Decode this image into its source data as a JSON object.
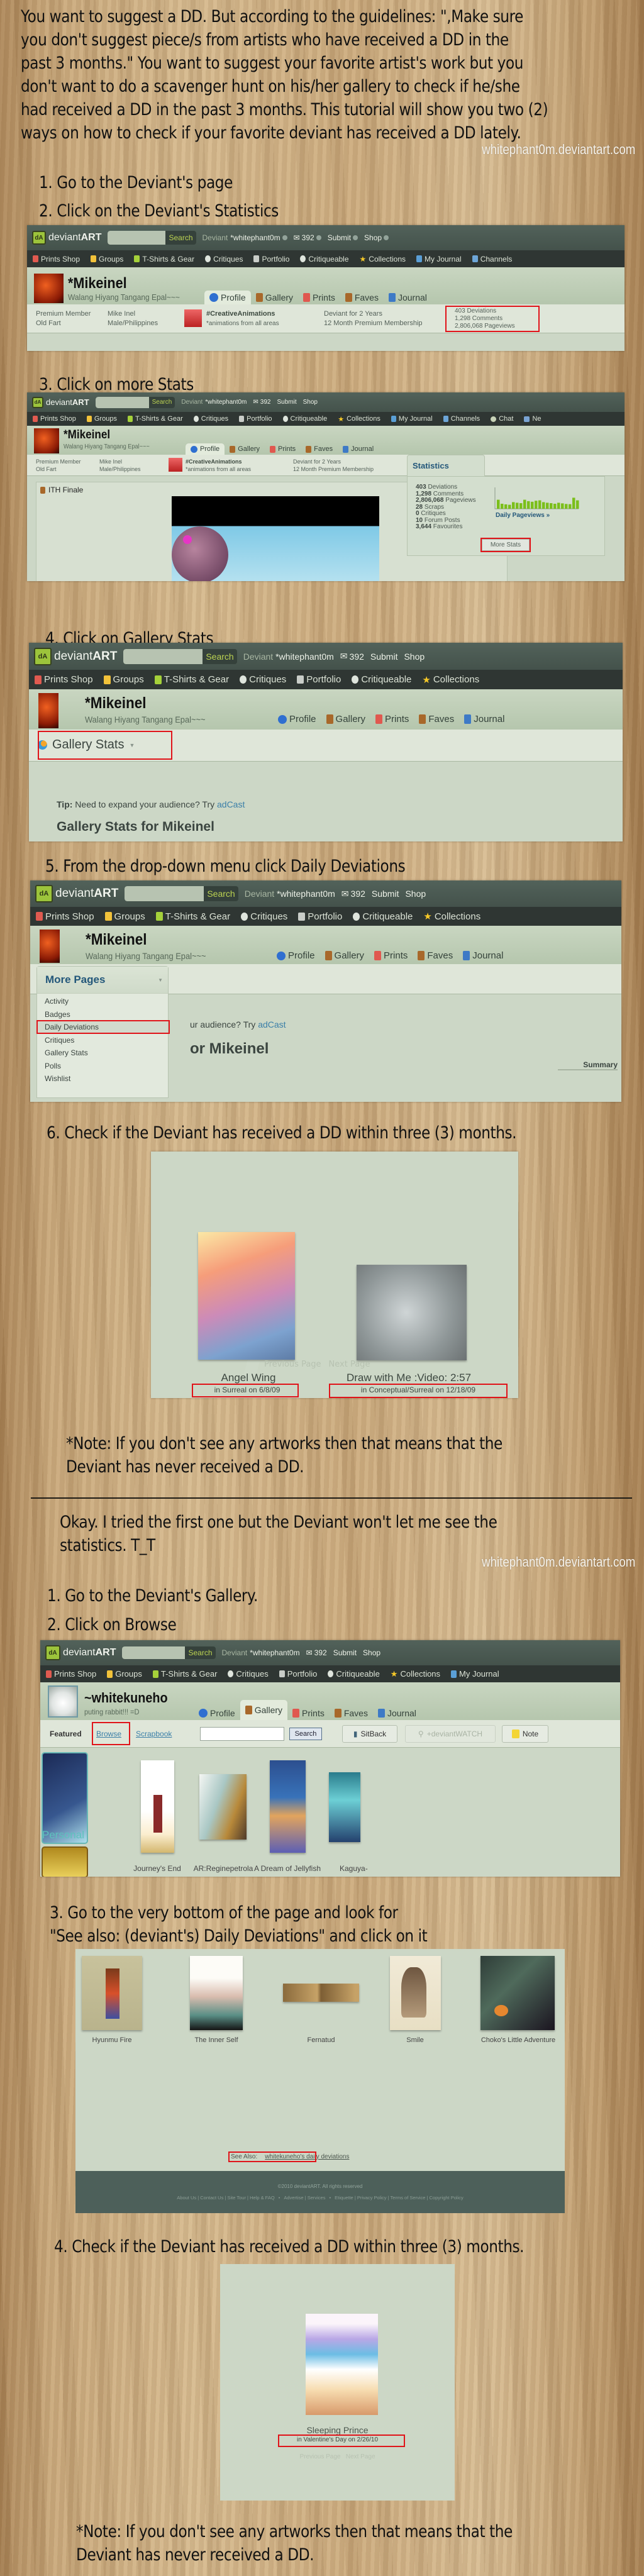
{
  "intro": {
    "lines": [
      "You want to suggest a DD. But according to the guidelines: \",Make sure",
      "you don't suggest piece/s from artists who have received a DD in the",
      "past 3 months.\" You want to suggest your favorite artist's work but you",
      "don't want to do a scavenger hunt on his/her gallery to check if he/she",
      "had received a DD in the past 3 months. This tutorial will show you two (2)",
      "ways on how to check if your favorite deviant has received a DD lately."
    ],
    "watermark": "whitephant0m.deviantart.com"
  },
  "da_chrome": {
    "logo_text_light": "deviant",
    "logo_text_bold": "ART",
    "search_label": "Search",
    "deviant_label": "Deviant",
    "current_user": "*whitephant0m",
    "message_count": "392",
    "submit_label": "Submit",
    "shop_label": "Shop",
    "nav_items": [
      "Prints Shop",
      "Groups",
      "T-Shirts & Gear",
      "Critiques",
      "Portfolio",
      "Critiqueable",
      "Collections",
      "My Journal",
      "Channels",
      "Chat",
      "Ne"
    ],
    "profile_tabs": [
      "Profile",
      "Gallery",
      "Prints",
      "Faves",
      "Journal"
    ]
  },
  "method1": {
    "step1": "1. Go to the Deviant's page",
    "step2": "2. Click on the Deviant's Statistics",
    "step3": "3. Click on more Stats",
    "step4": "4. Click on Gallery Stats",
    "step5": "5. From the drop-down menu click Daily Deviations",
    "step6": "6. Check if the Deviant has received a DD within three (3) months.",
    "profile": {
      "username": "*Mikeinel",
      "tagline": "Walang Hiyang Tangang Epal~~~",
      "member_type": "Premium Member",
      "member_title": "Old Fart",
      "real_name": "Mike Inel",
      "gender_country": "Male/Philippines",
      "group_name": "#CreativeAnimations",
      "group_desc": "*animations from all areas",
      "deviant_for": "Deviant for 2 Years",
      "membership": "12 Month Premium Membership",
      "stats_short": [
        "403 Deviations",
        "1,298 Comments",
        "2,806,068 Pageviews"
      ]
    },
    "statistics_panel": {
      "title": "Statistics",
      "rows": [
        {
          "value": "403",
          "label": "Deviations"
        },
        {
          "value": "1,298",
          "label": "Comments"
        },
        {
          "value": "2,806,068",
          "label": "Pageviews"
        },
        {
          "value": "28",
          "label": "Scraps"
        },
        {
          "value": "0",
          "label": "Critiques"
        },
        {
          "value": "10",
          "label": "Forum Posts"
        },
        {
          "value": "3,644",
          "label": "Favourites"
        }
      ],
      "daily_pageviews_link": "Daily Pageviews »",
      "daily_pageviews_bars": [
        0.45,
        0.25,
        0.22,
        0.2,
        0.33,
        0.3,
        0.28,
        0.45,
        0.38,
        0.35,
        0.4,
        0.42,
        0.33,
        0.3,
        0.28,
        0.25,
        0.3,
        0.27,
        0.24,
        0.23,
        0.55,
        0.42
      ],
      "more_stats_button": "More Stats",
      "featured_title": "ITH Finale"
    },
    "gallery_stats": {
      "dropdown_label": "Gallery Stats",
      "tip_label": "Tip:",
      "tip_text": "Need to expand your audience? Try",
      "tip_link": "adCast",
      "heading": "Gallery Stats for Mikeinel"
    },
    "more_pages": {
      "label": "More Pages",
      "items": [
        "Activity",
        "Badges",
        "Daily Deviations",
        "Critiques",
        "Gallery Stats",
        "Polls",
        "Wishlist"
      ],
      "partial_tip": "ur audience? Try",
      "partial_heading": "or Mikeinel",
      "summary_label": "Summary"
    },
    "dd_results": [
      {
        "title": "Angel Wing",
        "caption": "in Surreal on 6/8/09"
      },
      {
        "title": "Draw with Me :Video: 2:57",
        "caption": "in Conceptual/Surreal on 12/18/09"
      }
    ],
    "pagination": {
      "prev": "Previous Page",
      "next": "Next Page"
    },
    "note": [
      "*Note: If you don't see any artworks then that means that the",
      "Deviant has never received a DD."
    ]
  },
  "method2": {
    "intro": [
      "Okay. I tried the first one but the Deviant won't let me see the",
      "statistics. T_T"
    ],
    "watermark": "whitephant0m.deviantart.com",
    "step1": "1. Go to the Deviant's Gallery.",
    "step2": "2. Click on Browse",
    "profile": {
      "username": "~whitekuneho",
      "tagline": "puting rabbit!!! =D"
    },
    "gallery_toolbar": {
      "featured": "Featured",
      "browse": "Browse",
      "scrapbook": "Scrapbook",
      "search_button": "Search",
      "sitback": "SitBack",
      "devwatch": "+deviantWATCH",
      "note": "Note"
    },
    "folder_label": "Personal",
    "gallery_items": [
      "Journey's End",
      "AR:Reginepetrola",
      "A Dream of Jellyfish",
      "Kaguya-"
    ],
    "step3_lines": [
      "3. Go to the very bottom of the page and look for",
      "\"See also: (deviant's) Daily Deviations\" and click on it"
    ],
    "bottom_items": [
      "Hyunmu Fire",
      "The Inner Self",
      "Fernatud",
      "Smile",
      "Choko's Little Adventure"
    ],
    "see_also_label": "See Also:",
    "see_also_link": "whitekuneho's daily deviations",
    "footer_copyright": "©2010 deviantART. All rights reserved",
    "footer_links": [
      "About Us",
      "Contact Us",
      "Site Tour",
      "Help & FAQ",
      "•",
      "Advertise",
      "Services",
      "•",
      "Etiquette",
      "Privacy Policy",
      "Terms of Service",
      "Copyright Policy"
    ],
    "step4": "4. Check if the Deviant has received a DD within three (3) months.",
    "dd_result": {
      "title": "Sleeping Prince",
      "caption": "in Valentine's Day on 2/26/10"
    },
    "pagination": {
      "prev": "Previous Page",
      "next": "Next Page"
    },
    "note": [
      "*Note: If you don't see any artworks then that means that the",
      "Deviant has never received a DD."
    ]
  },
  "colors": {
    "highlight_box": "#e0141a",
    "da_green": "#9cc43b",
    "da_page_bg": "#ccd7c6",
    "link_blue": "#3b7fa8"
  }
}
